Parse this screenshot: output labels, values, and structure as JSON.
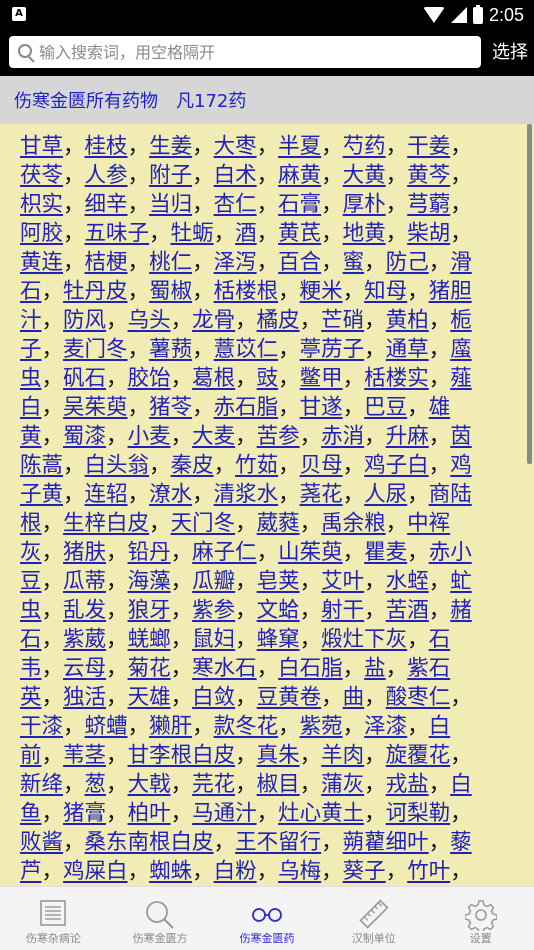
{
  "status": {
    "time": "2:05",
    "app_badge": "A"
  },
  "search": {
    "placeholder": "输入搜索词，用空格隔开",
    "select_label": "选择"
  },
  "header": {
    "title": "伤寒金匮所有药物　凡172药"
  },
  "herbs": [
    "甘草",
    "桂枝",
    "生姜",
    "大枣",
    "半夏",
    "芍药",
    "干姜",
    "茯苓",
    "人参",
    "附子",
    "白术",
    "麻黄",
    "大黄",
    "黄芩",
    "枳实",
    "细辛",
    "当归",
    "杏仁",
    "石膏",
    "厚朴",
    "芎藭",
    "阿胶",
    "五味子",
    "牡蛎",
    "酒",
    "黄芪",
    "地黄",
    "柴胡",
    "黄连",
    "桔梗",
    "桃仁",
    "泽泻",
    "百合",
    "蜜",
    "防己",
    "滑石",
    "牡丹皮",
    "蜀椒",
    "栝楼根",
    "粳米",
    "知母",
    "猪胆汁",
    "防风",
    "乌头",
    "龙骨",
    "橘皮",
    "芒硝",
    "黄柏",
    "栀子",
    "麦门冬",
    "薯蓣",
    "薏苡仁",
    "葶苈子",
    "通草",
    "䗪虫",
    "矾石",
    "胶饴",
    "葛根",
    "豉",
    "鳖甲",
    "栝楼实",
    "薤白",
    "吴茱萸",
    "猪苓",
    "赤石脂",
    "甘遂",
    "巴豆",
    "雄黄",
    "蜀漆",
    "小麦",
    "大麦",
    "苦参",
    "赤消",
    "升麻",
    "茵陈蒿",
    "白头翁",
    "秦皮",
    "竹茹",
    "贝母",
    "鸡子白",
    "鸡子黄",
    "连轺",
    "潦水",
    "清浆水",
    "荛花",
    "人尿",
    "商陆根",
    "生梓白皮",
    "天门冬",
    "葳蕤",
    "禹余粮",
    "中裈灰",
    "猪肤",
    "铅丹",
    "麻子仁",
    "山茱萸",
    "瞿麦",
    "赤小豆",
    "瓜蒂",
    "海藻",
    "瓜瓣",
    "皂荚",
    "艾叶",
    "水蛭",
    "虻虫",
    "乱发",
    "狼牙",
    "紫参",
    "文蛤",
    "射干",
    "苦酒",
    "赭石",
    "紫葳",
    "蜣螂",
    "鼠妇",
    "蜂窠",
    "煅灶下灰",
    "石韦",
    "云母",
    "菊花",
    "寒水石",
    "白石脂",
    "盐",
    "紫石英",
    "独活",
    "天雄",
    "白敛",
    "豆黄卷",
    "曲",
    "酸枣仁",
    "干漆",
    "蛴螬",
    "獭肝",
    "款冬花",
    "紫菀",
    "泽漆",
    "白前",
    "苇茎",
    "甘李根白皮",
    "真朱",
    "羊肉",
    "旋覆花",
    "新绛",
    "葱",
    "大戟",
    "芫花",
    "椒目",
    "蒲灰",
    "戎盐",
    "白鱼",
    "猪膏",
    "柏叶",
    "马通汁",
    "灶心黄土",
    "诃梨勒",
    "败酱",
    "桑东南根白皮",
    "王不留行",
    "蒴藋细叶",
    "藜芦",
    "鸡屎白",
    "蜘蛛",
    "白粉",
    "乌梅",
    "葵子",
    "竹叶"
  ],
  "separator": "，",
  "nav": [
    {
      "label": "伤寒杂病论",
      "icon": "document-icon"
    },
    {
      "label": "伤寒金匮方",
      "icon": "search-icon"
    },
    {
      "label": "伤寒金匮药",
      "icon": "glasses-icon"
    },
    {
      "label": "汉制单位",
      "icon": "ruler-icon"
    },
    {
      "label": "设置",
      "icon": "gear-icon"
    }
  ],
  "colors": {
    "content_bg": "#f1ecb4",
    "link": "#2222bb",
    "active_nav": "#2a2ad0",
    "header_bg": "#d6d6d6"
  }
}
